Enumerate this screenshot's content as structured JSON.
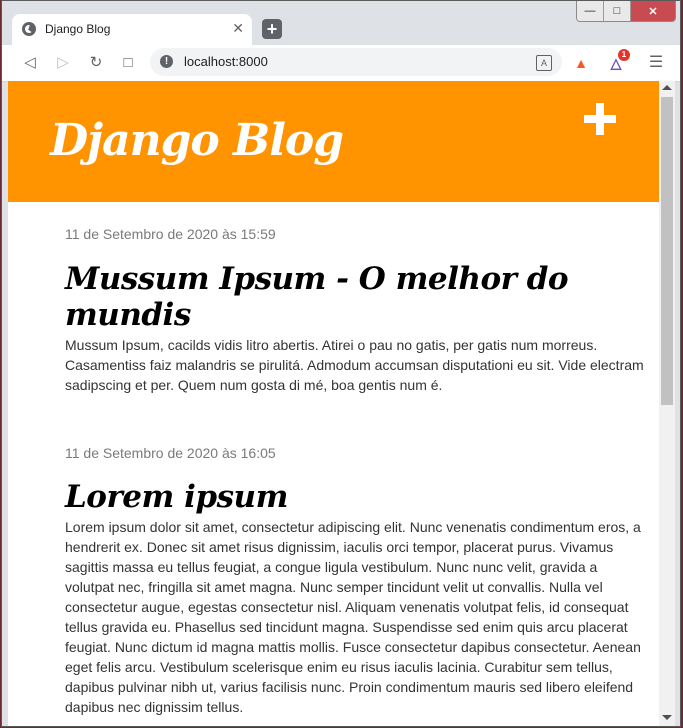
{
  "browser": {
    "tab_title": "Django Blog",
    "new_tab_label": "+",
    "address": "localhost:8000",
    "rewards_badge": "1"
  },
  "site": {
    "brand": "Django Blog",
    "add_icon": "plus-icon"
  },
  "posts": [
    {
      "date": "11 de Setembro de 2020 às 15:59",
      "title": "Mussum Ipsum - O melhor do mundis",
      "body": "Mussum Ipsum, cacilds vidis litro abertis. Atirei o pau no gatis, per gatis num morreus. Casamentiss faiz malandris se pirulitá. Admodum accumsan disputationi eu sit. Vide electram sadipscing et per. Quem num gosta di mé, boa gentis num é."
    },
    {
      "date": "11 de Setembro de 2020 às 16:05",
      "title": "Lorem ipsum",
      "body": "Lorem ipsum dolor sit amet, consectetur adipiscing elit. Nunc venenatis condimentum eros, a hendrerit ex. Donec sit amet risus dignissim, iaculis orci tempor, placerat purus. Vivamus sagittis massa eu tellus feugiat, a congue ligula vestibulum. Nunc nunc velit, gravida a volutpat nec, fringilla sit amet magna. Nunc semper tincidunt velit ut convallis. Nulla vel consectetur augue, egestas consectetur nisl. Aliquam venenatis volutpat felis, id consequat tellus gravida eu. Phasellus sed tincidunt magna. Suspendisse sed enim quis arcu placerat feugiat. Nunc dictum id magna mattis mollis. Fusce consectetur dapibus consectetur. Aenean eget felis arcu. Vestibulum scelerisque enim eu risus iaculis lacinia. Curabitur sem tellus, dapibus pulvinar nibh ut, varius facilisis nunc. Proin condimentum mauris sed libero eleifend dapibus nec dignissim tellus."
    }
  ],
  "colors": {
    "header": "#ff9400",
    "date_text": "#7a7a7a"
  }
}
